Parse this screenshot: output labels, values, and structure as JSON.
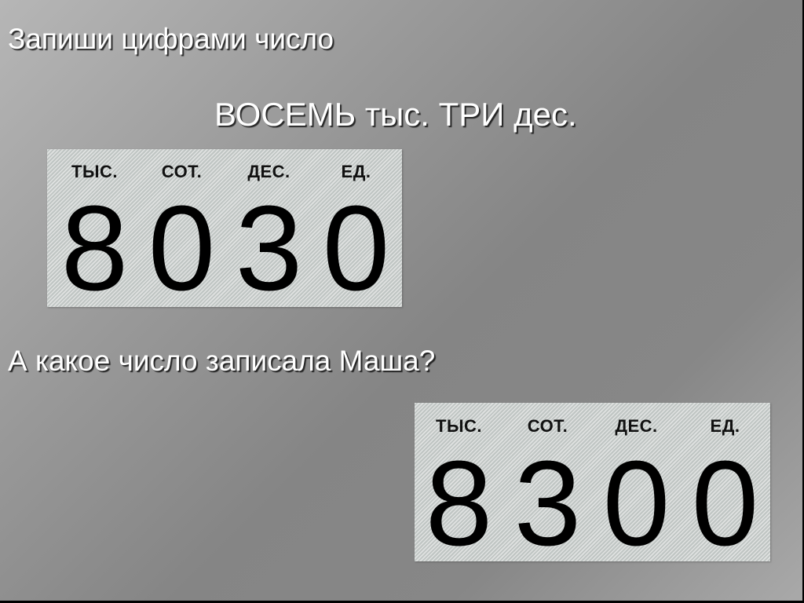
{
  "slide": {
    "title": "Запиши цифрами число",
    "number_in_words": "ВОСЕМЬ тыс. ТРИ дес.",
    "question": "А какое число записала Маша?",
    "colors": {
      "text": "#ffffff",
      "box_background": "#cfd3d1",
      "digit": "#000000"
    }
  },
  "correct_table": {
    "columns": [
      {
        "label": "ТЫС.",
        "digit": "8"
      },
      {
        "label": "СОТ.",
        "digit": "0"
      },
      {
        "label": "ДЕС.",
        "digit": "3"
      },
      {
        "label": "ЕД.",
        "digit": "0"
      }
    ]
  },
  "masha_table": {
    "columns": [
      {
        "label": "ТЫС.",
        "digit": "8"
      },
      {
        "label": "СОТ.",
        "digit": "3"
      },
      {
        "label": "ДЕС.",
        "digit": "0"
      },
      {
        "label": "ЕД.",
        "digit": "0"
      }
    ]
  }
}
